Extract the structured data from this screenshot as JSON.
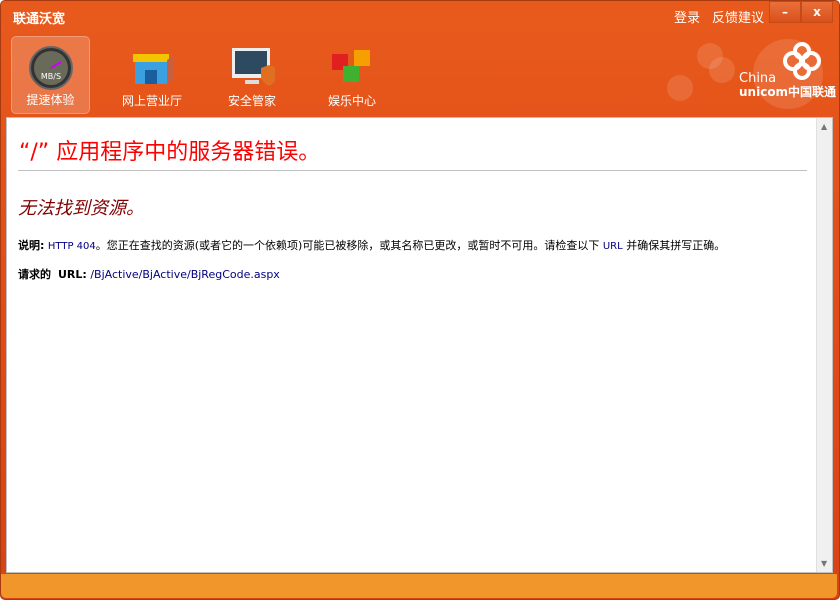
{
  "window": {
    "title": "联通沃宽",
    "login": "登录",
    "feedback": "反馈建议",
    "minimize": "–",
    "close": "x"
  },
  "nav": [
    {
      "label": "提速体验",
      "icon": "speedometer-icon",
      "gauge": "MB/S"
    },
    {
      "label": "网上营业厅",
      "icon": "store-icon"
    },
    {
      "label": "安全管家",
      "icon": "monitor-shield-icon"
    },
    {
      "label": "娱乐中心",
      "icon": "cubes-icon"
    }
  ],
  "logo": {
    "line1": "China",
    "line2": "unicom中国联通"
  },
  "page": {
    "heading": "“/” 应用程序中的服务器错误。",
    "subheading": "无法找到资源。",
    "desc_label": "说明:",
    "desc_code": "HTTP 404",
    "desc_text1": "。您正在查找的资源(或者它的一个依赖项)可能已被移除，或其名称已更改，或暂时不可用。请检查以下",
    "desc_url": "URL",
    "desc_text2": "并确保其拼写正确。",
    "req_label": "请求的",
    "req_url_label": "URL:",
    "req_url": "/BjActive/BjActive/BjRegCode.aspx"
  }
}
